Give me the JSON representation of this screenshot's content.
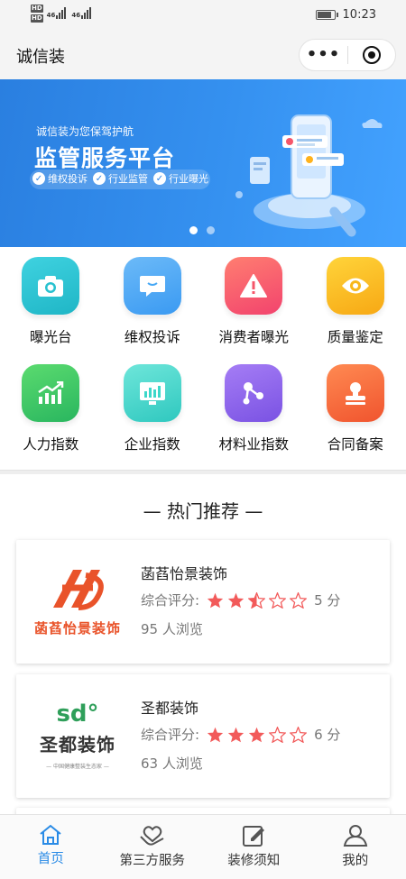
{
  "status": {
    "signal": "46",
    "time": "10:23"
  },
  "navbar": {
    "title": "诚信装",
    "more": "•••"
  },
  "banner": {
    "subtitle": "诚信装为您保驾护航",
    "title": "监管服务平台",
    "tags": [
      "维权投诉",
      "行业监管",
      "行业曝光"
    ]
  },
  "grid": [
    {
      "label": "曝光台",
      "icon": "camera-icon",
      "color": "#27c1cf"
    },
    {
      "label": "维权投诉",
      "icon": "chat-icon",
      "color": "#47a8f5"
    },
    {
      "label": "消费者曝光",
      "icon": "warning-icon",
      "color": "#f5566a"
    },
    {
      "label": "质量鉴定",
      "icon": "eye-icon",
      "color": "#f8b81a"
    },
    {
      "label": "人力指数",
      "icon": "growth-chart-icon",
      "color": "#3ec96a"
    },
    {
      "label": "企业指数",
      "icon": "bar-chart-icon",
      "color": "#3cd7c9"
    },
    {
      "label": "材料业指数",
      "icon": "molecule-icon",
      "color": "#8d63ea"
    },
    {
      "label": "合同备案",
      "icon": "stamp-icon",
      "color": "#f66a3c"
    }
  ],
  "section": {
    "title": "— 热门推荐 —"
  },
  "cards": [
    {
      "name": "菡萏怡景装饰",
      "rate_label": "综合评分:",
      "score": "5 分",
      "stars": 2.5,
      "views": "95 人浏览",
      "logo_text": "菡萏怡景装饰",
      "logo_mark": "HD"
    },
    {
      "name": "圣都装饰",
      "rate_label": "综合评分:",
      "score": "6 分",
      "stars": 3,
      "views": "63 人浏览",
      "logo_text": "圣都装饰",
      "logo_mark": "sd°",
      "logo_sub": "— 中国健康整装生态家 —"
    }
  ],
  "tabs": [
    {
      "label": "首页",
      "icon": "home-icon",
      "active": true
    },
    {
      "label": "第三方服务",
      "icon": "handshake-icon",
      "active": false
    },
    {
      "label": "装修须知",
      "icon": "edit-icon",
      "active": false
    },
    {
      "label": "我的",
      "icon": "user-icon",
      "active": false
    }
  ],
  "colors": {
    "primary": "#2a8be6",
    "star": "#f25a5a"
  }
}
